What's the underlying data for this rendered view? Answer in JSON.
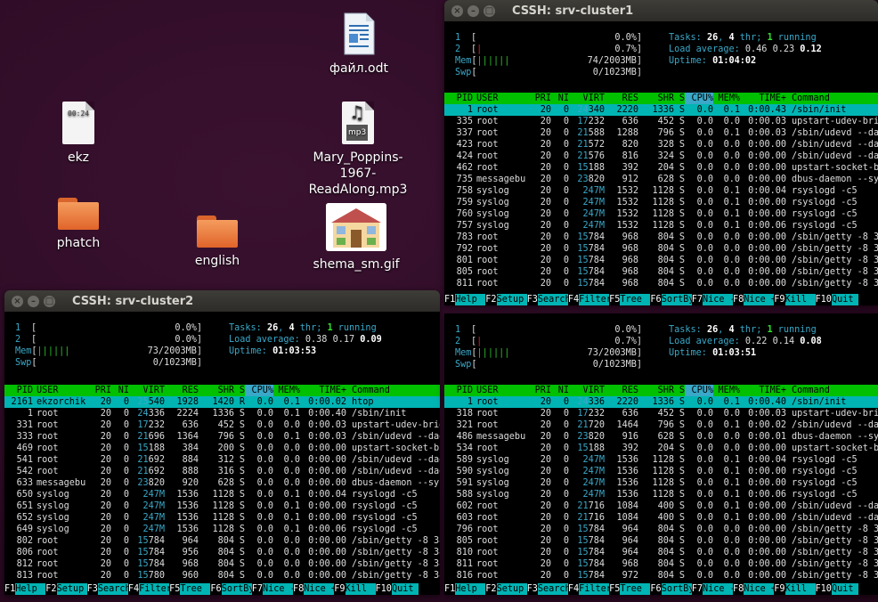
{
  "desktop": {
    "icons": [
      {
        "label": "файл.odt",
        "type": "odt"
      },
      {
        "label": "ekz",
        "type": "txt",
        "thumb": "00:24"
      },
      {
        "label": "Mary_Poppins-1967-ReadAlong.mp3",
        "type": "mp3",
        "badge": "mp3"
      },
      {
        "label": "phatch",
        "type": "folder"
      },
      {
        "label": "english",
        "type": "folder"
      },
      {
        "label": "shema_sm.gif",
        "type": "gif"
      }
    ]
  },
  "windows": [
    {
      "title": "CSSH: srv-cluster1",
      "meters": [
        {
          "n": "1",
          "val": "0.0%]",
          "bar": "",
          "color": "g"
        },
        {
          "n": "2",
          "val": "0.7%]",
          "bar": "|",
          "color": "r"
        },
        {
          "n": "Mem",
          "val": "74/2003MB]",
          "bar": "||||||",
          "color": "mix"
        },
        {
          "n": "Swp",
          "val": "0/1023MB]",
          "bar": "",
          "color": "g"
        }
      ],
      "tasks": {
        "label": "Tasks:",
        "count": "26",
        "sep": ",",
        "thr": "4",
        "thr_label": "thr;",
        "running": "1",
        "running_label": "running"
      },
      "load": {
        "label": "Load average:",
        "v1": "0.46",
        "v2": "0.23",
        "v3": "0.12"
      },
      "uptime": {
        "label": "Uptime:",
        "value": "01:04:02"
      },
      "rows": [
        [
          "1",
          "root",
          "20",
          "0",
          "24340",
          "2220",
          "1336",
          "S",
          "0.0",
          "0.1",
          "0:00.43",
          "/sbin/init"
        ],
        [
          "335",
          "root",
          "20",
          "0",
          "17232",
          "636",
          "452",
          "S",
          "0.0",
          "0.0",
          "0:00.03",
          "upstart-udev-brid"
        ],
        [
          "337",
          "root",
          "20",
          "0",
          "21588",
          "1288",
          "796",
          "S",
          "0.0",
          "0.1",
          "0:00.03",
          "/sbin/udevd --dae"
        ],
        [
          "423",
          "root",
          "20",
          "0",
          "21572",
          "820",
          "328",
          "S",
          "0.0",
          "0.0",
          "0:00.00",
          "/sbin/udevd --dae"
        ],
        [
          "424",
          "root",
          "20",
          "0",
          "21576",
          "816",
          "324",
          "S",
          "0.0",
          "0.0",
          "0:00.00",
          "/sbin/udevd --dae"
        ],
        [
          "462",
          "root",
          "20",
          "0",
          "15188",
          "392",
          "204",
          "S",
          "0.0",
          "0.0",
          "0:00.00",
          "upstart-socket-br"
        ],
        [
          "735",
          "messagebu",
          "20",
          "0",
          "23820",
          "912",
          "628",
          "S",
          "0.0",
          "0.0",
          "0:00.00",
          "dbus-daemon --sys"
        ],
        [
          "758",
          "syslog",
          "20",
          "0",
          "247M",
          "1532",
          "1128",
          "S",
          "0.0",
          "0.1",
          "0:00.04",
          "rsyslogd -c5"
        ],
        [
          "759",
          "syslog",
          "20",
          "0",
          "247M",
          "1532",
          "1128",
          "S",
          "0.0",
          "0.1",
          "0:00.00",
          "rsyslogd -c5"
        ],
        [
          "760",
          "syslog",
          "20",
          "0",
          "247M",
          "1532",
          "1128",
          "S",
          "0.0",
          "0.1",
          "0:00.00",
          "rsyslogd -c5"
        ],
        [
          "757",
          "syslog",
          "20",
          "0",
          "247M",
          "1532",
          "1128",
          "S",
          "0.0",
          "0.1",
          "0:00.06",
          "rsyslogd -c5"
        ],
        [
          "783",
          "root",
          "20",
          "0",
          "15784",
          "968",
          "804",
          "S",
          "0.0",
          "0.0",
          "0:00.00",
          "/sbin/getty -8 38"
        ],
        [
          "792",
          "root",
          "20",
          "0",
          "15784",
          "968",
          "804",
          "S",
          "0.0",
          "0.0",
          "0:00.00",
          "/sbin/getty -8 38"
        ],
        [
          "801",
          "root",
          "20",
          "0",
          "15784",
          "968",
          "804",
          "S",
          "0.0",
          "0.0",
          "0:00.00",
          "/sbin/getty -8 38"
        ],
        [
          "805",
          "root",
          "20",
          "0",
          "15784",
          "968",
          "804",
          "S",
          "0.0",
          "0.0",
          "0:00.00",
          "/sbin/getty -8 38"
        ],
        [
          "811",
          "root",
          "20",
          "0",
          "15784",
          "968",
          "804",
          "S",
          "0.0",
          "0.0",
          "0:00.00",
          "/sbin/getty -8 38"
        ]
      ]
    },
    {
      "title": "CSSH: srv-cluster2",
      "meters": [
        {
          "n": "1",
          "val": "0.0%]",
          "bar": "",
          "color": "g"
        },
        {
          "n": "2",
          "val": "0.0%]",
          "bar": "",
          "color": "g"
        },
        {
          "n": "Mem",
          "val": "73/2003MB]",
          "bar": "||||||",
          "color": "mix"
        },
        {
          "n": "Swp",
          "val": "0/1023MB]",
          "bar": "",
          "color": "g"
        }
      ],
      "tasks": {
        "label": "Tasks:",
        "count": "26",
        "sep": ",",
        "thr": "4",
        "thr_label": "thr;",
        "running": "1",
        "running_label": "running"
      },
      "load": {
        "label": "Load average:",
        "v1": "0.38",
        "v2": "0.17",
        "v3": "0.09"
      },
      "uptime": {
        "label": "Uptime:",
        "value": "01:03:53"
      },
      "rows": [
        [
          "2161",
          "ekzorchik",
          "20",
          "0",
          "25540",
          "1928",
          "1420",
          "R",
          "0.0",
          "0.1",
          "0:00.02",
          "htop"
        ],
        [
          "1",
          "root",
          "20",
          "0",
          "24336",
          "2224",
          "1336",
          "S",
          "0.0",
          "0.1",
          "0:00.40",
          "/sbin/init"
        ],
        [
          "331",
          "root",
          "20",
          "0",
          "17232",
          "636",
          "452",
          "S",
          "0.0",
          "0.0",
          "0:00.03",
          "upstart-udev-brid"
        ],
        [
          "333",
          "root",
          "20",
          "0",
          "21696",
          "1364",
          "796",
          "S",
          "0.0",
          "0.1",
          "0:00.03",
          "/sbin/udevd --dae"
        ],
        [
          "469",
          "root",
          "20",
          "0",
          "15188",
          "384",
          "200",
          "S",
          "0.0",
          "0.0",
          "0:00.00",
          "upstart-socket-br"
        ],
        [
          "541",
          "root",
          "20",
          "0",
          "21692",
          "884",
          "312",
          "S",
          "0.0",
          "0.0",
          "0:00.00",
          "/sbin/udevd --dae"
        ],
        [
          "542",
          "root",
          "20",
          "0",
          "21692",
          "888",
          "316",
          "S",
          "0.0",
          "0.0",
          "0:00.00",
          "/sbin/udevd --dae"
        ],
        [
          "633",
          "messagebu",
          "20",
          "0",
          "23820",
          "920",
          "628",
          "S",
          "0.0",
          "0.0",
          "0:00.00",
          "dbus-daemon --sys"
        ],
        [
          "650",
          "syslog",
          "20",
          "0",
          "247M",
          "1536",
          "1128",
          "S",
          "0.0",
          "0.1",
          "0:00.04",
          "rsyslogd -c5"
        ],
        [
          "651",
          "syslog",
          "20",
          "0",
          "247M",
          "1536",
          "1128",
          "S",
          "0.0",
          "0.1",
          "0:00.00",
          "rsyslogd -c5"
        ],
        [
          "652",
          "syslog",
          "20",
          "0",
          "247M",
          "1536",
          "1128",
          "S",
          "0.0",
          "0.1",
          "0:00.00",
          "rsyslogd -c5"
        ],
        [
          "649",
          "syslog",
          "20",
          "0",
          "247M",
          "1536",
          "1128",
          "S",
          "0.0",
          "0.1",
          "0:00.06",
          "rsyslogd -c5"
        ],
        [
          "802",
          "root",
          "20",
          "0",
          "15784",
          "964",
          "804",
          "S",
          "0.0",
          "0.0",
          "0:00.00",
          "/sbin/getty -8 38"
        ],
        [
          "806",
          "root",
          "20",
          "0",
          "15784",
          "956",
          "804",
          "S",
          "0.0",
          "0.0",
          "0:00.00",
          "/sbin/getty -8 38"
        ],
        [
          "812",
          "root",
          "20",
          "0",
          "15784",
          "968",
          "804",
          "S",
          "0.0",
          "0.0",
          "0:00.00",
          "/sbin/getty -8 38"
        ],
        [
          "813",
          "root",
          "20",
          "0",
          "15780",
          "960",
          "804",
          "S",
          "0.0",
          "0.0",
          "0:00.00",
          "/sbin/getty -8 38"
        ]
      ]
    },
    {
      "title": "",
      "meters": [
        {
          "n": "1",
          "val": "0.0%]",
          "bar": "",
          "color": "g"
        },
        {
          "n": "2",
          "val": "0.7%]",
          "bar": "|",
          "color": "r"
        },
        {
          "n": "Mem",
          "val": "73/2003MB]",
          "bar": "||||||",
          "color": "mix"
        },
        {
          "n": "Swp",
          "val": "0/1023MB]",
          "bar": "",
          "color": "g"
        }
      ],
      "tasks": {
        "label": "Tasks:",
        "count": "26",
        "sep": ",",
        "thr": "4",
        "thr_label": "thr;",
        "running": "1",
        "running_label": "running"
      },
      "load": {
        "label": "Load average:",
        "v1": "0.22",
        "v2": "0.14",
        "v3": "0.08"
      },
      "uptime": {
        "label": "Uptime:",
        "value": "01:03:51"
      },
      "rows": [
        [
          "1",
          "root",
          "20",
          "0",
          "24336",
          "2220",
          "1336",
          "S",
          "0.0",
          "0.1",
          "0:00.40",
          "/sbin/init"
        ],
        [
          "318",
          "root",
          "20",
          "0",
          "17232",
          "636",
          "452",
          "S",
          "0.0",
          "0.0",
          "0:00.03",
          "upstart-udev-brid"
        ],
        [
          "321",
          "root",
          "20",
          "0",
          "21720",
          "1464",
          "796",
          "S",
          "0.0",
          "0.1",
          "0:00.02",
          "/sbin/udevd --dae"
        ],
        [
          "486",
          "messagebu",
          "20",
          "0",
          "23820",
          "916",
          "628",
          "S",
          "0.0",
          "0.0",
          "0:00.01",
          "dbus-daemon --sys"
        ],
        [
          "534",
          "root",
          "20",
          "0",
          "15188",
          "392",
          "204",
          "S",
          "0.0",
          "0.0",
          "0:00.00",
          "upstart-socket-br"
        ],
        [
          "589",
          "syslog",
          "20",
          "0",
          "247M",
          "1536",
          "1128",
          "S",
          "0.0",
          "0.1",
          "0:00.04",
          "rsyslogd -c5"
        ],
        [
          "590",
          "syslog",
          "20",
          "0",
          "247M",
          "1536",
          "1128",
          "S",
          "0.0",
          "0.1",
          "0:00.00",
          "rsyslogd -c5"
        ],
        [
          "591",
          "syslog",
          "20",
          "0",
          "247M",
          "1536",
          "1128",
          "S",
          "0.0",
          "0.1",
          "0:00.00",
          "rsyslogd -c5"
        ],
        [
          "588",
          "syslog",
          "20",
          "0",
          "247M",
          "1536",
          "1128",
          "S",
          "0.0",
          "0.1",
          "0:00.06",
          "rsyslogd -c5"
        ],
        [
          "602",
          "root",
          "20",
          "0",
          "21716",
          "1084",
          "400",
          "S",
          "0.0",
          "0.1",
          "0:00.00",
          "/sbin/udevd --dae"
        ],
        [
          "603",
          "root",
          "20",
          "0",
          "21716",
          "1084",
          "400",
          "S",
          "0.0",
          "0.1",
          "0:00.00",
          "/sbin/udevd --dae"
        ],
        [
          "796",
          "root",
          "20",
          "0",
          "15784",
          "964",
          "804",
          "S",
          "0.0",
          "0.0",
          "0:00.00",
          "/sbin/getty -8 38"
        ],
        [
          "805",
          "root",
          "20",
          "0",
          "15784",
          "964",
          "804",
          "S",
          "0.0",
          "0.0",
          "0:00.00",
          "/sbin/getty -8 38"
        ],
        [
          "810",
          "root",
          "20",
          "0",
          "15784",
          "964",
          "804",
          "S",
          "0.0",
          "0.0",
          "0:00.00",
          "/sbin/getty -8 38"
        ],
        [
          "811",
          "root",
          "20",
          "0",
          "15784",
          "968",
          "804",
          "S",
          "0.0",
          "0.0",
          "0:00.00",
          "/sbin/getty -8 38"
        ],
        [
          "816",
          "root",
          "20",
          "0",
          "15784",
          "972",
          "804",
          "S",
          "0.0",
          "0.0",
          "0:00.00",
          "/sbin/getty -8 38"
        ]
      ]
    }
  ],
  "columns": [
    "PID",
    "USER",
    "PRI",
    "NI",
    "VIRT",
    "RES",
    "SHR",
    "S",
    "CPU%",
    "MEM%",
    "TIME+",
    "Command"
  ],
  "fkeys": [
    {
      "k": "F1",
      "l": "Help"
    },
    {
      "k": "F2",
      "l": "Setup"
    },
    {
      "k": "F3",
      "l": "Search"
    },
    {
      "k": "F4",
      "l": "Filter"
    },
    {
      "k": "F5",
      "l": "Tree"
    },
    {
      "k": "F6",
      "l": "SortBy"
    },
    {
      "k": "F7",
      "l": "Nice -"
    },
    {
      "k": "F8",
      "l": "Nice +"
    },
    {
      "k": "F9",
      "l": "Kill"
    },
    {
      "k": "F10",
      "l": "Quit"
    }
  ],
  "colors": {
    "header_green": "#00c000",
    "select_cyan": "#00b4b4",
    "label_cyan": "#3aa8c8",
    "desktop_bg": "#2c0a24"
  }
}
